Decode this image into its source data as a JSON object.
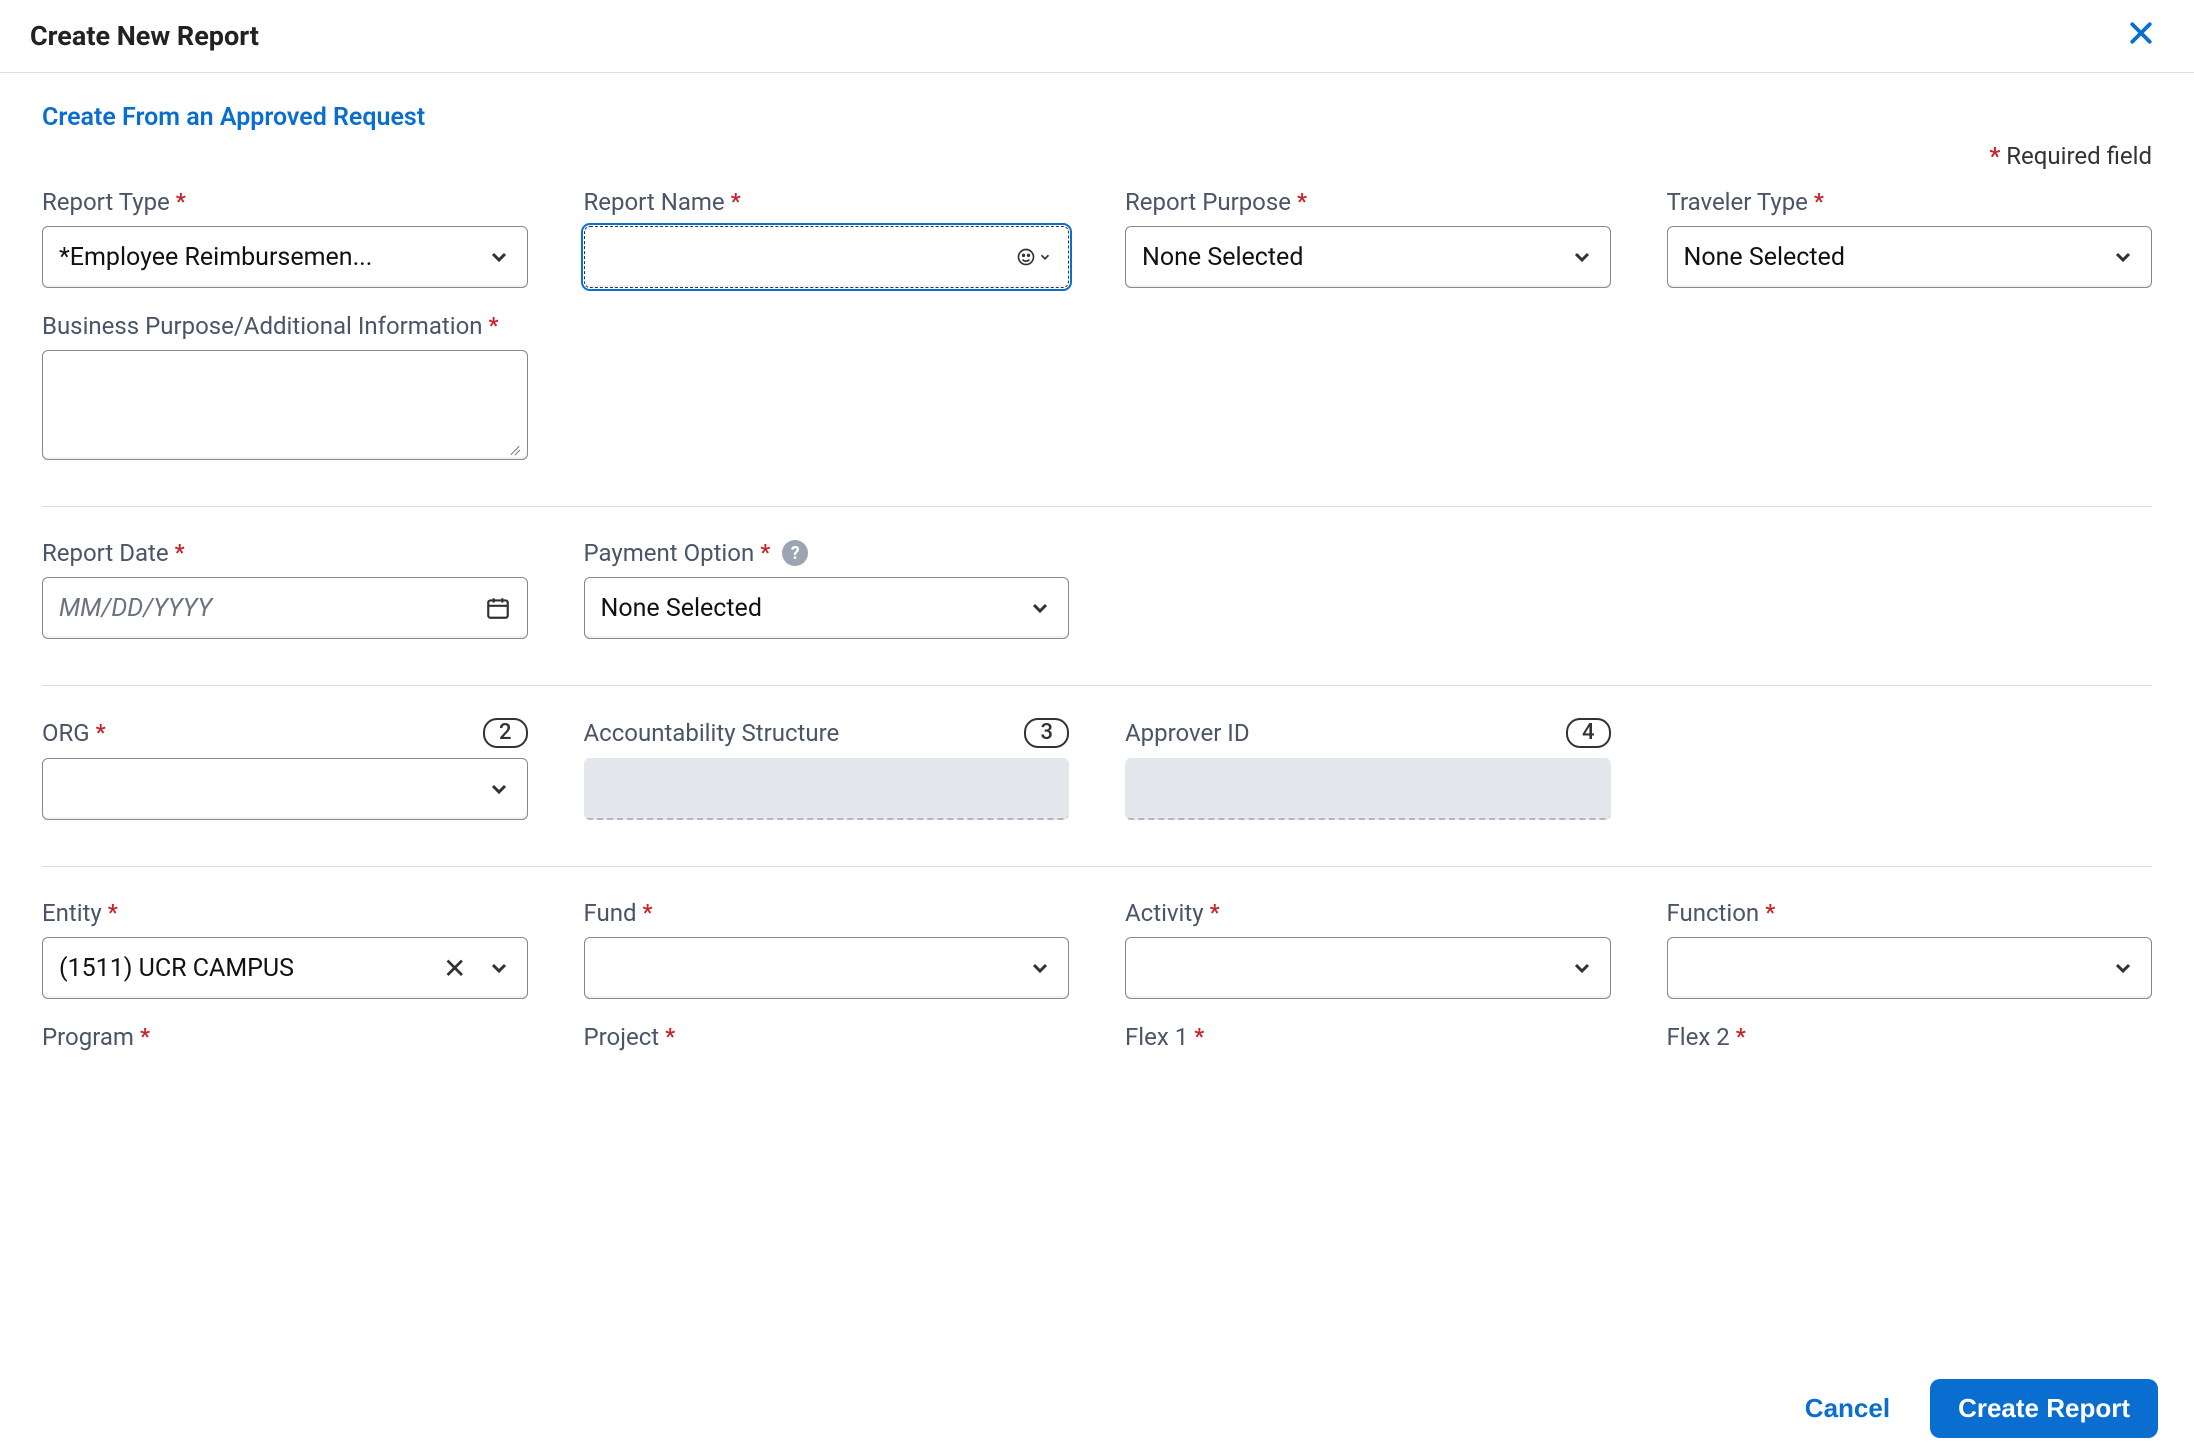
{
  "header": {
    "title": "Create New Report"
  },
  "link": {
    "approved_request": "Create From an Approved Request"
  },
  "required_note": "Required field",
  "section1": {
    "report_type": {
      "label": "Report Type",
      "value": "*Employee Reimbursemen..."
    },
    "report_name": {
      "label": "Report Name",
      "value": ""
    },
    "report_purpose": {
      "label": "Report Purpose",
      "value": "None Selected"
    },
    "traveler_type": {
      "label": "Traveler Type",
      "value": "None Selected"
    },
    "business_purpose": {
      "label": "Business Purpose/Additional Information",
      "value": ""
    }
  },
  "section2": {
    "report_date": {
      "label": "Report Date",
      "placeholder": "MM/DD/YYYY"
    },
    "payment_option": {
      "label": "Payment Option",
      "value": "None Selected"
    }
  },
  "section3": {
    "org": {
      "label": "ORG",
      "badge": "2",
      "value": ""
    },
    "accountability": {
      "label": "Accountability Structure",
      "badge": "3"
    },
    "approver_id": {
      "label": "Approver ID",
      "badge": "4"
    }
  },
  "section4": {
    "entity": {
      "label": "Entity",
      "value": "(1511) UCR CAMPUS"
    },
    "fund": {
      "label": "Fund",
      "value": ""
    },
    "activity": {
      "label": "Activity",
      "value": ""
    },
    "function": {
      "label": "Function",
      "value": ""
    },
    "program": {
      "label": "Program"
    },
    "project": {
      "label": "Project"
    },
    "flex1": {
      "label": "Flex 1"
    },
    "flex2": {
      "label": "Flex 2"
    }
  },
  "footer": {
    "cancel": "Cancel",
    "create": "Create Report"
  }
}
